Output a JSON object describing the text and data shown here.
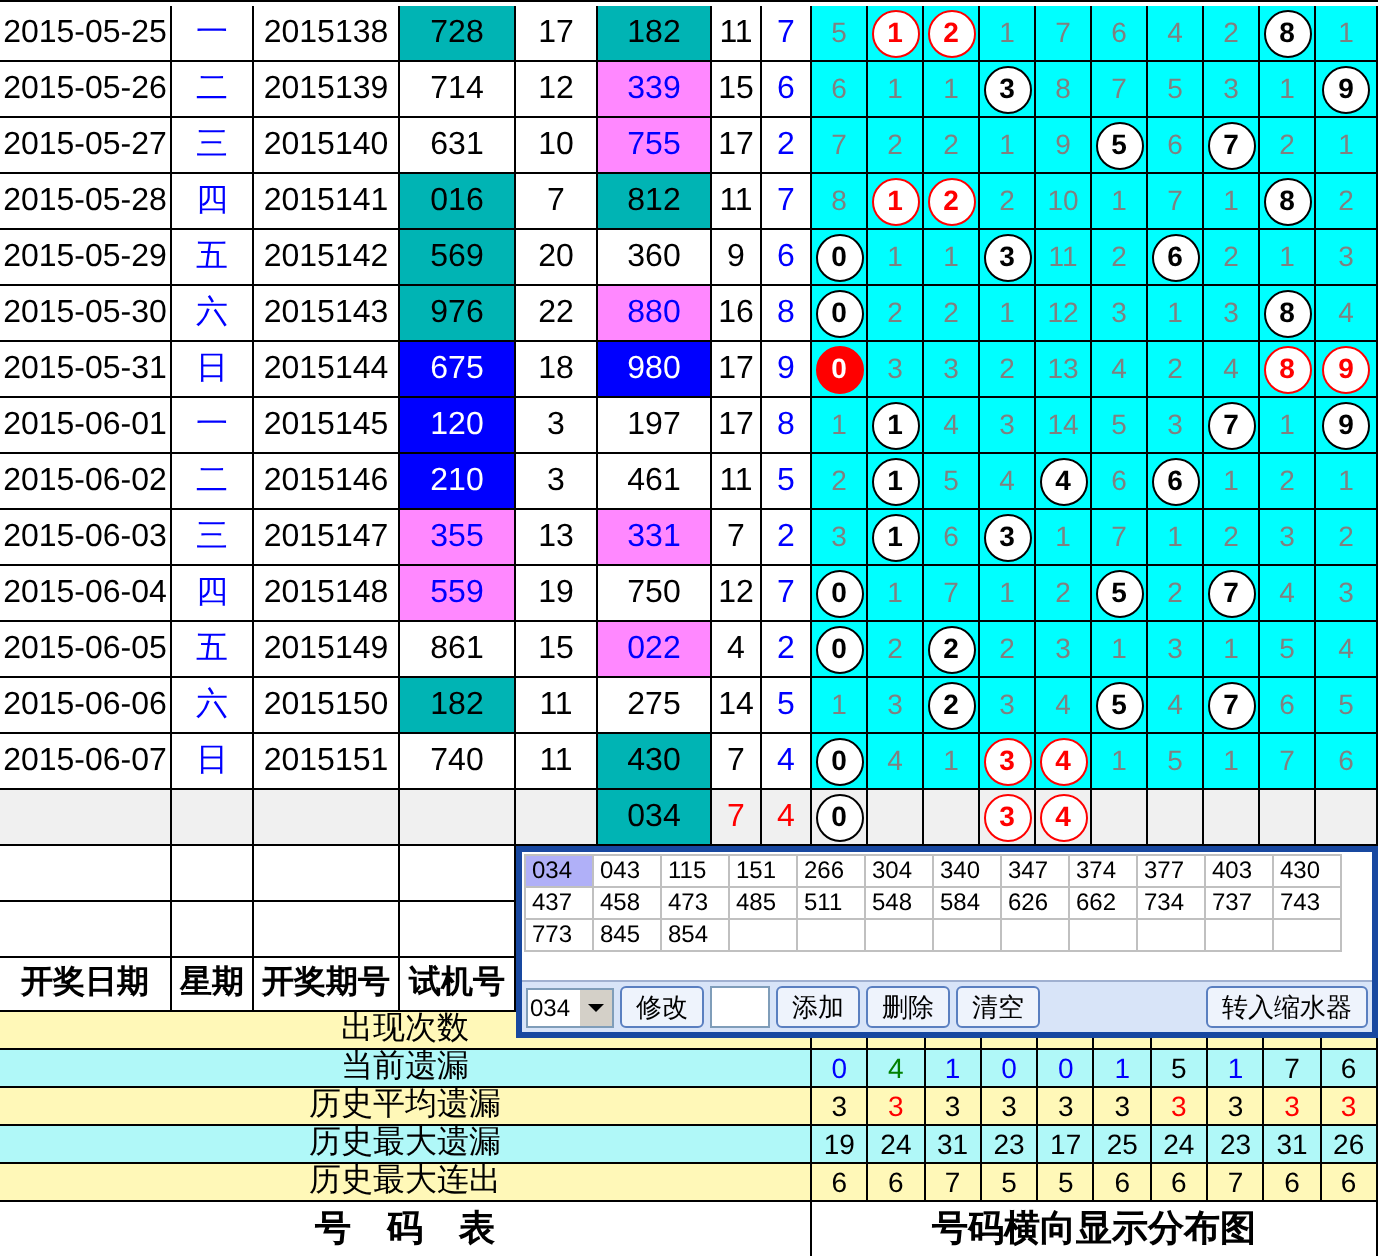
{
  "rows": [
    {
      "kind": "draw",
      "date": "2015-05-25",
      "weekday": "一",
      "issue": "2015138",
      "test_number": {
        "text": "728",
        "color": "#00b4b4"
      },
      "column_5": "17",
      "draw_number": {
        "text": "182",
        "color": "#00b4b4"
      },
      "column_7": "11",
      "column_8": "7",
      "grid": [
        {
          "kind": "miss",
          "text": "5"
        },
        {
          "kind": "hit",
          "text": "1",
          "color": "#ff0000",
          "filled": false
        },
        {
          "kind": "hit",
          "text": "2",
          "color": "#ff0000",
          "filled": false
        },
        {
          "kind": "miss",
          "text": "1"
        },
        {
          "kind": "miss",
          "text": "7"
        },
        {
          "kind": "miss",
          "text": "6"
        },
        {
          "kind": "miss",
          "text": "4"
        },
        {
          "kind": "miss",
          "text": "2"
        },
        {
          "kind": "hit",
          "text": "8",
          "color": "#000000",
          "filled": false
        },
        {
          "kind": "miss",
          "text": "1"
        }
      ]
    },
    {
      "kind": "draw",
      "date": "2015-05-26",
      "weekday": "二",
      "issue": "2015139",
      "test_number": {
        "text": "714"
      },
      "column_5": "12",
      "draw_number": {
        "text": "339",
        "color": "#ff88ff"
      },
      "column_7": "15",
      "column_8": "6",
      "grid": [
        {
          "kind": "miss",
          "text": "6"
        },
        {
          "kind": "miss",
          "text": "1"
        },
        {
          "kind": "miss",
          "text": "1"
        },
        {
          "kind": "hit",
          "text": "3",
          "color": "#000000",
          "filled": false
        },
        {
          "kind": "miss",
          "text": "8"
        },
        {
          "kind": "miss",
          "text": "7"
        },
        {
          "kind": "miss",
          "text": "5"
        },
        {
          "kind": "miss",
          "text": "3"
        },
        {
          "kind": "miss",
          "text": "1"
        },
        {
          "kind": "hit",
          "text": "9",
          "color": "#000000",
          "filled": false
        }
      ]
    },
    {
      "kind": "draw",
      "date": "2015-05-27",
      "weekday": "三",
      "issue": "2015140",
      "test_number": {
        "text": "631"
      },
      "column_5": "10",
      "draw_number": {
        "text": "755",
        "color": "#ff88ff"
      },
      "column_7": "17",
      "column_8": "2",
      "grid": [
        {
          "kind": "miss",
          "text": "7"
        },
        {
          "kind": "miss",
          "text": "2"
        },
        {
          "kind": "miss",
          "text": "2"
        },
        {
          "kind": "miss",
          "text": "1"
        },
        {
          "kind": "miss",
          "text": "9"
        },
        {
          "kind": "hit",
          "text": "5",
          "color": "#000000",
          "filled": false
        },
        {
          "kind": "miss",
          "text": "6"
        },
        {
          "kind": "hit",
          "text": "7",
          "color": "#000000",
          "filled": false
        },
        {
          "kind": "miss",
          "text": "2"
        },
        {
          "kind": "miss",
          "text": "1"
        }
      ]
    },
    {
      "kind": "draw",
      "date": "2015-05-28",
      "weekday": "四",
      "issue": "2015141",
      "test_number": {
        "text": "016",
        "color": "#00b4b4"
      },
      "column_5": "7",
      "draw_number": {
        "text": "812",
        "color": "#00b4b4"
      },
      "column_7": "11",
      "column_8": "7",
      "grid": [
        {
          "kind": "miss",
          "text": "8"
        },
        {
          "kind": "hit",
          "text": "1",
          "color": "#ff0000",
          "filled": false
        },
        {
          "kind": "hit",
          "text": "2",
          "color": "#ff0000",
          "filled": false
        },
        {
          "kind": "miss",
          "text": "2"
        },
        {
          "kind": "miss",
          "text": "10"
        },
        {
          "kind": "miss",
          "text": "1"
        },
        {
          "kind": "miss",
          "text": "7"
        },
        {
          "kind": "miss",
          "text": "1"
        },
        {
          "kind": "hit",
          "text": "8",
          "color": "#000000",
          "filled": false
        },
        {
          "kind": "miss",
          "text": "2"
        }
      ]
    },
    {
      "kind": "draw",
      "date": "2015-05-29",
      "weekday": "五",
      "issue": "2015142",
      "test_number": {
        "text": "569",
        "color": "#00b4b4"
      },
      "column_5": "20",
      "draw_number": {
        "text": "360"
      },
      "column_7": "9",
      "column_8": "6",
      "grid": [
        {
          "kind": "hit",
          "text": "0",
          "color": "#000000",
          "filled": false
        },
        {
          "kind": "miss",
          "text": "1"
        },
        {
          "kind": "miss",
          "text": "1"
        },
        {
          "kind": "hit",
          "text": "3",
          "color": "#000000",
          "filled": false
        },
        {
          "kind": "miss",
          "text": "11"
        },
        {
          "kind": "miss",
          "text": "2"
        },
        {
          "kind": "hit",
          "text": "6",
          "color": "#000000",
          "filled": false
        },
        {
          "kind": "miss",
          "text": "2"
        },
        {
          "kind": "miss",
          "text": "1"
        },
        {
          "kind": "miss",
          "text": "3"
        }
      ]
    },
    {
      "kind": "draw",
      "date": "2015-05-30",
      "weekday": "六",
      "issue": "2015143",
      "test_number": {
        "text": "976",
        "color": "#00b4b4"
      },
      "column_5": "22",
      "draw_number": {
        "text": "880",
        "color": "#ff88ff"
      },
      "column_7": "16",
      "column_8": "8",
      "grid": [
        {
          "kind": "hit",
          "text": "0",
          "color": "#000000",
          "filled": false
        },
        {
          "kind": "miss",
          "text": "2"
        },
        {
          "kind": "miss",
          "text": "2"
        },
        {
          "kind": "miss",
          "text": "1"
        },
        {
          "kind": "miss",
          "text": "12"
        },
        {
          "kind": "miss",
          "text": "3"
        },
        {
          "kind": "miss",
          "text": "1"
        },
        {
          "kind": "miss",
          "text": "3"
        },
        {
          "kind": "hit",
          "text": "8",
          "color": "#000000",
          "filled": false
        },
        {
          "kind": "miss",
          "text": "4"
        }
      ]
    },
    {
      "kind": "draw",
      "date": "2015-05-31",
      "weekday": "日",
      "issue": "2015144",
      "test_number": {
        "text": "675",
        "color": "#0000ff"
      },
      "column_5": "18",
      "draw_number": {
        "text": "980",
        "color": "#0000ff"
      },
      "column_7": "17",
      "column_8": "9",
      "grid": [
        {
          "kind": "hit",
          "text": "0",
          "color": "#ff0000",
          "filled": true
        },
        {
          "kind": "miss",
          "text": "3"
        },
        {
          "kind": "miss",
          "text": "3"
        },
        {
          "kind": "miss",
          "text": "2"
        },
        {
          "kind": "miss",
          "text": "13"
        },
        {
          "kind": "miss",
          "text": "4"
        },
        {
          "kind": "miss",
          "text": "2"
        },
        {
          "kind": "miss",
          "text": "4"
        },
        {
          "kind": "hit",
          "text": "8",
          "color": "#ff0000",
          "filled": false
        },
        {
          "kind": "hit",
          "text": "9",
          "color": "#ff0000",
          "filled": false
        }
      ]
    },
    {
      "kind": "draw",
      "date": "2015-06-01",
      "weekday": "一",
      "issue": "2015145",
      "test_number": {
        "text": "120",
        "color": "#0000ff"
      },
      "column_5": "3",
      "draw_number": {
        "text": "197"
      },
      "column_7": "17",
      "column_8": "8",
      "grid": [
        {
          "kind": "miss",
          "text": "1"
        },
        {
          "kind": "hit",
          "text": "1",
          "color": "#000000",
          "filled": false
        },
        {
          "kind": "miss",
          "text": "4"
        },
        {
          "kind": "miss",
          "text": "3"
        },
        {
          "kind": "miss",
          "text": "14"
        },
        {
          "kind": "miss",
          "text": "5"
        },
        {
          "kind": "miss",
          "text": "3"
        },
        {
          "kind": "hit",
          "text": "7",
          "color": "#000000",
          "filled": false
        },
        {
          "kind": "miss",
          "text": "1"
        },
        {
          "kind": "hit",
          "text": "9",
          "color": "#000000",
          "filled": false
        }
      ]
    },
    {
      "kind": "draw",
      "date": "2015-06-02",
      "weekday": "二",
      "issue": "2015146",
      "test_number": {
        "text": "210",
        "color": "#0000ff"
      },
      "column_5": "3",
      "draw_number": {
        "text": "461"
      },
      "column_7": "11",
      "column_8": "5",
      "grid": [
        {
          "kind": "miss",
          "text": "2"
        },
        {
          "kind": "hit",
          "text": "1",
          "color": "#000000",
          "filled": false
        },
        {
          "kind": "miss",
          "text": "5"
        },
        {
          "kind": "miss",
          "text": "4"
        },
        {
          "kind": "hit",
          "text": "4",
          "color": "#000000",
          "filled": false
        },
        {
          "kind": "miss",
          "text": "6"
        },
        {
          "kind": "hit",
          "text": "6",
          "color": "#000000",
          "filled": false
        },
        {
          "kind": "miss",
          "text": "1"
        },
        {
          "kind": "miss",
          "text": "2"
        },
        {
          "kind": "miss",
          "text": "1"
        }
      ]
    },
    {
      "kind": "draw",
      "date": "2015-06-03",
      "weekday": "三",
      "issue": "2015147",
      "test_number": {
        "text": "355",
        "color": "#ff88ff"
      },
      "column_5": "13",
      "draw_number": {
        "text": "331",
        "color": "#ff88ff"
      },
      "column_7": "7",
      "column_8": "2",
      "grid": [
        {
          "kind": "miss",
          "text": "3"
        },
        {
          "kind": "hit",
          "text": "1",
          "color": "#000000",
          "filled": false
        },
        {
          "kind": "miss",
          "text": "6"
        },
        {
          "kind": "hit",
          "text": "3",
          "color": "#000000",
          "filled": false
        },
        {
          "kind": "miss",
          "text": "1"
        },
        {
          "kind": "miss",
          "text": "7"
        },
        {
          "kind": "miss",
          "text": "1"
        },
        {
          "kind": "miss",
          "text": "2"
        },
        {
          "kind": "miss",
          "text": "3"
        },
        {
          "kind": "miss",
          "text": "2"
        }
      ]
    },
    {
      "kind": "draw",
      "date": "2015-06-04",
      "weekday": "四",
      "issue": "2015148",
      "test_number": {
        "text": "559",
        "color": "#ff88ff"
      },
      "column_5": "19",
      "draw_number": {
        "text": "750"
      },
      "column_7": "12",
      "column_8": "7",
      "grid": [
        {
          "kind": "hit",
          "text": "0",
          "color": "#000000",
          "filled": false
        },
        {
          "kind": "miss",
          "text": "1"
        },
        {
          "kind": "miss",
          "text": "7"
        },
        {
          "kind": "miss",
          "text": "1"
        },
        {
          "kind": "miss",
          "text": "2"
        },
        {
          "kind": "hit",
          "text": "5",
          "color": "#000000",
          "filled": false
        },
        {
          "kind": "miss",
          "text": "2"
        },
        {
          "kind": "hit",
          "text": "7",
          "color": "#000000",
          "filled": false
        },
        {
          "kind": "miss",
          "text": "4"
        },
        {
          "kind": "miss",
          "text": "3"
        }
      ]
    },
    {
      "kind": "draw",
      "date": "2015-06-05",
      "weekday": "五",
      "issue": "2015149",
      "test_number": {
        "text": "861"
      },
      "column_5": "15",
      "draw_number": {
        "text": "022",
        "color": "#ff88ff"
      },
      "column_7": "4",
      "column_8": "2",
      "grid": [
        {
          "kind": "hit",
          "text": "0",
          "color": "#000000",
          "filled": false
        },
        {
          "kind": "miss",
          "text": "2"
        },
        {
          "kind": "hit",
          "text": "2",
          "color": "#000000",
          "filled": false
        },
        {
          "kind": "miss",
          "text": "2"
        },
        {
          "kind": "miss",
          "text": "3"
        },
        {
          "kind": "miss",
          "text": "1"
        },
        {
          "kind": "miss",
          "text": "3"
        },
        {
          "kind": "miss",
          "text": "1"
        },
        {
          "kind": "miss",
          "text": "5"
        },
        {
          "kind": "miss",
          "text": "4"
        }
      ]
    },
    {
      "kind": "draw",
      "date": "2015-06-06",
      "weekday": "六",
      "issue": "2015150",
      "test_number": {
        "text": "182",
        "color": "#00b4b4"
      },
      "column_5": "11",
      "draw_number": {
        "text": "275"
      },
      "column_7": "14",
      "column_8": "5",
      "grid": [
        {
          "kind": "miss",
          "text": "1"
        },
        {
          "kind": "miss",
          "text": "3"
        },
        {
          "kind": "hit",
          "text": "2",
          "color": "#000000",
          "filled": false
        },
        {
          "kind": "miss",
          "text": "3"
        },
        {
          "kind": "miss",
          "text": "4"
        },
        {
          "kind": "hit",
          "text": "5",
          "color": "#000000",
          "filled": false
        },
        {
          "kind": "miss",
          "text": "4"
        },
        {
          "kind": "hit",
          "text": "7",
          "color": "#000000",
          "filled": false
        },
        {
          "kind": "miss",
          "text": "6"
        },
        {
          "kind": "miss",
          "text": "5"
        }
      ]
    },
    {
      "kind": "draw",
      "date": "2015-06-07",
      "weekday": "日",
      "issue": "2015151",
      "test_number": {
        "text": "740"
      },
      "column_5": "11",
      "draw_number": {
        "text": "430",
        "color": "#00b4b4"
      },
      "column_7": "7",
      "column_8": "4",
      "grid": [
        {
          "kind": "hit",
          "text": "0",
          "color": "#000000",
          "filled": false
        },
        {
          "kind": "miss",
          "text": "4"
        },
        {
          "kind": "miss",
          "text": "1"
        },
        {
          "kind": "hit",
          "text": "3",
          "color": "#ff0000",
          "filled": false
        },
        {
          "kind": "hit",
          "text": "4",
          "color": "#ff0000",
          "filled": false
        },
        {
          "kind": "miss",
          "text": "1"
        },
        {
          "kind": "miss",
          "text": "5"
        },
        {
          "kind": "miss",
          "text": "1"
        },
        {
          "kind": "miss",
          "text": "7"
        },
        {
          "kind": "miss",
          "text": "6"
        }
      ]
    },
    {
      "kind": "pending",
      "draw_number": {
        "text": "034",
        "color": "#00b4b4"
      },
      "column_7": "7",
      "column_8": "4",
      "grid": [
        {
          "kind": "hit",
          "text": "0",
          "color": "#000000",
          "filled": false
        },
        {
          "kind": "empty"
        },
        {
          "kind": "empty"
        },
        {
          "kind": "hit",
          "text": "3",
          "color": "#ff0000",
          "filled": false
        },
        {
          "kind": "hit",
          "text": "4",
          "color": "#ff0000",
          "filled": false
        },
        {
          "kind": "empty"
        },
        {
          "kind": "empty"
        },
        {
          "kind": "empty"
        },
        {
          "kind": "empty"
        },
        {
          "kind": "empty"
        }
      ]
    }
  ],
  "headers": [
    "开奖日期",
    "星期",
    "开奖期号",
    "试机号"
  ],
  "stats": [
    {
      "label": "出现次数",
      "color": "#fff8b8"
    },
    {
      "label": "当前遗漏",
      "color": "#b0f8f8",
      "values": [
        {
          "text": "0",
          "color": "#0000ff"
        },
        {
          "text": "4",
          "color": "#008000"
        },
        {
          "text": "1",
          "color": "#0000ff"
        },
        {
          "text": "0",
          "color": "#0000ff"
        },
        {
          "text": "0",
          "color": "#0000ff"
        },
        {
          "text": "1",
          "color": "#0000ff"
        },
        {
          "text": "5",
          "color": "#000000"
        },
        {
          "text": "1",
          "color": "#0000ff"
        },
        {
          "text": "7",
          "color": "#000000"
        },
        {
          "text": "6",
          "color": "#000000"
        }
      ]
    },
    {
      "label": "历史平均遗漏",
      "color": "#fff8b8",
      "values": [
        {
          "text": "3",
          "color": "#000000"
        },
        {
          "text": "3",
          "color": "#ff0000"
        },
        {
          "text": "3",
          "color": "#000000"
        },
        {
          "text": "3",
          "color": "#000000"
        },
        {
          "text": "3",
          "color": "#000000"
        },
        {
          "text": "3",
          "color": "#000000"
        },
        {
          "text": "3",
          "color": "#ff0000"
        },
        {
          "text": "3",
          "color": "#000000"
        },
        {
          "text": "3",
          "color": "#ff0000"
        },
        {
          "text": "3",
          "color": "#ff0000"
        }
      ]
    },
    {
      "label": "历史最大遗漏",
      "color": "#b0f8f8",
      "values": [
        {
          "text": "19",
          "color": "#000000"
        },
        {
          "text": "24",
          "color": "#000000"
        },
        {
          "text": "31",
          "color": "#000000"
        },
        {
          "text": "23",
          "color": "#000000"
        },
        {
          "text": "17",
          "color": "#000000"
        },
        {
          "text": "25",
          "color": "#000000"
        },
        {
          "text": "24",
          "color": "#000000"
        },
        {
          "text": "23",
          "color": "#000000"
        },
        {
          "text": "31",
          "color": "#000000"
        },
        {
          "text": "26",
          "color": "#000000"
        }
      ]
    },
    {
      "label": "历史最大连出",
      "color": "#fff8b8",
      "values": [
        {
          "text": "6",
          "color": "#000000"
        },
        {
          "text": "6",
          "color": "#000000"
        },
        {
          "text": "7",
          "color": "#000000"
        },
        {
          "text": "5",
          "color": "#000000"
        },
        {
          "text": "5",
          "color": "#000000"
        },
        {
          "text": "6",
          "color": "#000000"
        },
        {
          "text": "6",
          "color": "#000000"
        },
        {
          "text": "7",
          "color": "#000000"
        },
        {
          "text": "6",
          "color": "#000000"
        },
        {
          "text": "6",
          "color": "#000000"
        }
      ]
    }
  ],
  "footer": {
    "left": "号　码　表",
    "right": "号码横向显示分布图"
  },
  "popup": {
    "numbers": [
      {
        "text": "034",
        "selected": true
      },
      {
        "text": "043",
        "selected": false
      },
      {
        "text": "115",
        "selected": false
      },
      {
        "text": "151",
        "selected": false
      },
      {
        "text": "266",
        "selected": false
      },
      {
        "text": "304",
        "selected": false
      },
      {
        "text": "340",
        "selected": false
      },
      {
        "text": "347",
        "selected": false
      },
      {
        "text": "374",
        "selected": false
      },
      {
        "text": "377",
        "selected": false
      },
      {
        "text": "403",
        "selected": false
      },
      {
        "text": "430",
        "selected": false
      },
      {
        "text": "437",
        "selected": false
      },
      {
        "text": "458",
        "selected": false
      },
      {
        "text": "473",
        "selected": false
      },
      {
        "text": "485",
        "selected": false
      },
      {
        "text": "511",
        "selected": false
      },
      {
        "text": "548",
        "selected": false
      },
      {
        "text": "584",
        "selected": false
      },
      {
        "text": "626",
        "selected": false
      },
      {
        "text": "662",
        "selected": false
      },
      {
        "text": "734",
        "selected": false
      },
      {
        "text": "737",
        "selected": false
      },
      {
        "text": "743",
        "selected": false
      },
      {
        "text": "773",
        "selected": false
      },
      {
        "text": "845",
        "selected": false
      },
      {
        "text": "854",
        "selected": false
      }
    ],
    "select_value": "034",
    "controls": [
      {
        "kind": "button",
        "text": "修改"
      },
      {
        "kind": "input"
      },
      {
        "kind": "button",
        "text": "添加"
      },
      {
        "kind": "button",
        "text": "删除"
      },
      {
        "kind": "button",
        "text": "清空"
      },
      {
        "kind": "spacer"
      },
      {
        "kind": "button",
        "text": "转入缩水器"
      }
    ]
  }
}
